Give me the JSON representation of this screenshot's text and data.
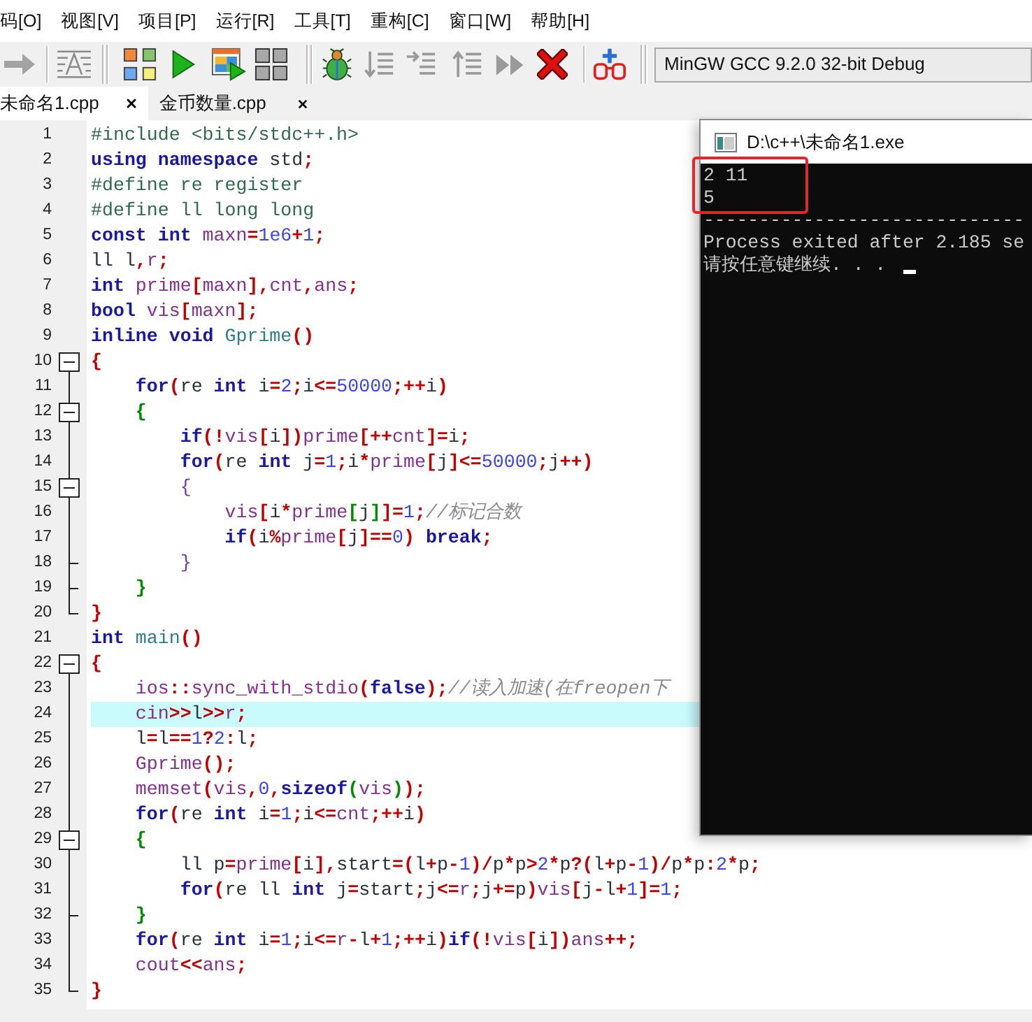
{
  "menu": [
    "码[O]",
    "视图[V]",
    "项目[P]",
    "运行[R]",
    "工具[T]",
    "重构[C]",
    "窗口[W]",
    "帮助[H]"
  ],
  "toolbar": {
    "compiler": "MinGW GCC 9.2.0 32-bit Debug"
  },
  "tabs": [
    {
      "label": "未命名1.cpp",
      "selected": true
    },
    {
      "label": "金币数量.cpp",
      "selected": false
    }
  ],
  "editor": {
    "lines": [
      {
        "number": "1",
        "selected": false,
        "kind": "plain",
        "tokens": [
          {
            "text": "#include <bits/stdc++.h>",
            "kind": "preprocessor"
          }
        ]
      },
      {
        "number": "2",
        "selected": false,
        "kind": "plain",
        "tokens": [
          {
            "text": "using namespace",
            "kind": "keyword"
          },
          {
            "text": " std",
            "kind": "plain"
          },
          {
            "text": ";",
            "kind": "symbol"
          }
        ]
      },
      {
        "number": "3",
        "selected": false,
        "kind": "plain",
        "tokens": [
          {
            "text": "#define re register",
            "kind": "preprocessor"
          }
        ]
      },
      {
        "number": "4",
        "selected": false,
        "kind": "plain",
        "tokens": [
          {
            "text": "#define ll long long",
            "kind": "preprocessor"
          }
        ]
      },
      {
        "number": "5",
        "selected": false,
        "kind": "plain",
        "tokens": [
          {
            "text": "const int",
            "kind": "keyword"
          },
          {
            "text": " maxn",
            "kind": "identifier"
          },
          {
            "text": "=",
            "kind": "symbol"
          },
          {
            "text": "1e6",
            "kind": "number"
          },
          {
            "text": "+",
            "kind": "symbol"
          },
          {
            "text": "1",
            "kind": "number"
          },
          {
            "text": ";",
            "kind": "symbol"
          }
        ]
      },
      {
        "number": "6",
        "selected": false,
        "kind": "plain",
        "tokens": [
          {
            "text": "ll l",
            "kind": "plain"
          },
          {
            "text": ",",
            "kind": "symbol"
          },
          {
            "text": "r",
            "kind": "identifier"
          },
          {
            "text": ";",
            "kind": "symbol"
          }
        ]
      },
      {
        "number": "7",
        "selected": false,
        "kind": "plain",
        "tokens": [
          {
            "text": "int",
            "kind": "keyword"
          },
          {
            "text": " prime",
            "kind": "identifier"
          },
          {
            "text": "[",
            "kind": "symbol"
          },
          {
            "text": "maxn",
            "kind": "identifier"
          },
          {
            "text": "],",
            "kind": "symbol"
          },
          {
            "text": "cnt",
            "kind": "identifier"
          },
          {
            "text": ",",
            "kind": "symbol"
          },
          {
            "text": "ans",
            "kind": "identifier"
          },
          {
            "text": ";",
            "kind": "symbol"
          }
        ]
      },
      {
        "number": "8",
        "selected": false,
        "kind": "plain",
        "tokens": [
          {
            "text": "bool",
            "kind": "keyword"
          },
          {
            "text": " vis",
            "kind": "identifier"
          },
          {
            "text": "[",
            "kind": "symbol"
          },
          {
            "text": "maxn",
            "kind": "identifier"
          },
          {
            "text": "];",
            "kind": "symbol"
          }
        ]
      },
      {
        "number": "9",
        "selected": false,
        "kind": "plain",
        "tokens": [
          {
            "text": "inline void",
            "kind": "keyword"
          },
          {
            "text": " Gprime",
            "kind": "function"
          },
          {
            "text": "()",
            "kind": "symbol"
          }
        ]
      },
      {
        "number": "10",
        "selected": false,
        "kind": "block",
        "expanded": true,
        "tokens": [
          {
            "text": "{",
            "kind": "symbol"
          }
        ]
      },
      {
        "number": "11",
        "selected": false,
        "kind": "plain",
        "tokens": [
          {
            "text": "    for",
            "kind": "keyword"
          },
          {
            "text": "(",
            "kind": "symbol"
          },
          {
            "text": "re ",
            "kind": "plain"
          },
          {
            "text": "int",
            "kind": "keyword"
          },
          {
            "text": " i",
            "kind": "plain"
          },
          {
            "text": "=",
            "kind": "symbol"
          },
          {
            "text": "2",
            "kind": "number"
          },
          {
            "text": ";",
            "kind": "symbol"
          },
          {
            "text": "i",
            "kind": "plain"
          },
          {
            "text": "<=",
            "kind": "symbol"
          },
          {
            "text": "50000",
            "kind": "number"
          },
          {
            "text": ";++",
            "kind": "symbol"
          },
          {
            "text": "i",
            "kind": "plain"
          },
          {
            "text": ")",
            "kind": "symbol"
          }
        ]
      },
      {
        "number": "12",
        "selected": false,
        "kind": "block",
        "expanded": true,
        "tokens": [
          {
            "text": "    {",
            "kind": "inner"
          }
        ]
      },
      {
        "number": "13",
        "selected": false,
        "kind": "plain",
        "tokens": [
          {
            "text": "        if",
            "kind": "keyword"
          },
          {
            "text": "(!",
            "kind": "symbol"
          },
          {
            "text": "vis",
            "kind": "identifier"
          },
          {
            "text": "[",
            "kind": "symbol"
          },
          {
            "text": "i",
            "kind": "plain"
          },
          {
            "text": "])",
            "kind": "symbol"
          },
          {
            "text": "prime",
            "kind": "identifier"
          },
          {
            "text": "[++",
            "kind": "symbol"
          },
          {
            "text": "cnt",
            "kind": "identifier"
          },
          {
            "text": "]=",
            "kind": "symbol"
          },
          {
            "text": "i",
            "kind": "plain"
          },
          {
            "text": ";",
            "kind": "symbol"
          }
        ]
      },
      {
        "number": "14",
        "selected": false,
        "kind": "plain",
        "tokens": [
          {
            "text": "        for",
            "kind": "keyword"
          },
          {
            "text": "(",
            "kind": "symbol"
          },
          {
            "text": "re ",
            "kind": "plain"
          },
          {
            "text": "int",
            "kind": "keyword"
          },
          {
            "text": " j",
            "kind": "plain"
          },
          {
            "text": "=",
            "kind": "symbol"
          },
          {
            "text": "1",
            "kind": "number"
          },
          {
            "text": ";",
            "kind": "symbol"
          },
          {
            "text": "i",
            "kind": "plain"
          },
          {
            "text": "*",
            "kind": "symbol"
          },
          {
            "text": "prime",
            "kind": "identifier"
          },
          {
            "text": "[",
            "kind": "symbol"
          },
          {
            "text": "j",
            "kind": "plain"
          },
          {
            "text": "]<=",
            "kind": "symbol"
          },
          {
            "text": "50000",
            "kind": "number"
          },
          {
            "text": ";",
            "kind": "symbol"
          },
          {
            "text": "j",
            "kind": "plain"
          },
          {
            "text": "++)",
            "kind": "symbol"
          }
        ]
      },
      {
        "number": "15",
        "selected": false,
        "kind": "block",
        "expanded": true,
        "tokens": [
          {
            "text": "        {",
            "kind": "innermost"
          }
        ]
      },
      {
        "number": "16",
        "selected": false,
        "kind": "plain",
        "tokens": [
          {
            "text": "            vis",
            "kind": "identifier"
          },
          {
            "text": "[",
            "kind": "symbol"
          },
          {
            "text": "i",
            "kind": "plain"
          },
          {
            "text": "*",
            "kind": "symbol"
          },
          {
            "text": "prime",
            "kind": "identifier"
          },
          {
            "text": "[",
            "kind": "inner"
          },
          {
            "text": "j",
            "kind": "plain"
          },
          {
            "text": "]",
            "kind": "inner"
          },
          {
            "text": "]=",
            "kind": "symbol"
          },
          {
            "text": "1",
            "kind": "number"
          },
          {
            "text": ";",
            "kind": "symbol"
          },
          {
            "text": "//标记合数",
            "kind": "comment"
          }
        ]
      },
      {
        "number": "17",
        "selected": false,
        "kind": "plain",
        "tokens": [
          {
            "text": "            if",
            "kind": "keyword"
          },
          {
            "text": "(",
            "kind": "symbol"
          },
          {
            "text": "i",
            "kind": "plain"
          },
          {
            "text": "%",
            "kind": "symbol"
          },
          {
            "text": "prime",
            "kind": "identifier"
          },
          {
            "text": "[",
            "kind": "symbol"
          },
          {
            "text": "j",
            "kind": "plain"
          },
          {
            "text": "]==",
            "kind": "symbol"
          },
          {
            "text": "0",
            "kind": "number"
          },
          {
            "text": ")",
            "kind": "symbol"
          },
          {
            "text": " break",
            "kind": "keyword"
          },
          {
            "text": ";",
            "kind": "symbol"
          }
        ]
      },
      {
        "number": "18",
        "selected": false,
        "kind": "branch",
        "tokens": [
          {
            "text": "        }",
            "kind": "innermost"
          }
        ]
      },
      {
        "number": "19",
        "selected": false,
        "kind": "branch",
        "tokens": [
          {
            "text": "    }",
            "kind": "inner"
          }
        ]
      },
      {
        "number": "20",
        "selected": false,
        "kind": "end",
        "tokens": [
          {
            "text": "}",
            "kind": "symbol"
          }
        ]
      },
      {
        "number": "21",
        "selected": false,
        "kind": "plain",
        "tokens": [
          {
            "text": "int",
            "kind": "keyword"
          },
          {
            "text": " main",
            "kind": "function"
          },
          {
            "text": "()",
            "kind": "symbol"
          }
        ]
      },
      {
        "number": "22",
        "selected": false,
        "kind": "block",
        "expanded": true,
        "tokens": [
          {
            "text": "{",
            "kind": "symbol"
          }
        ]
      },
      {
        "number": "23",
        "selected": false,
        "kind": "plain",
        "tokens": [
          {
            "text": "    ios",
            "kind": "identifier"
          },
          {
            "text": "::",
            "kind": "symbol"
          },
          {
            "text": "sync_with_stdio",
            "kind": "identifier"
          },
          {
            "text": "(",
            "kind": "symbol"
          },
          {
            "text": "false",
            "kind": "keyword"
          },
          {
            "text": ");",
            "kind": "symbol"
          },
          {
            "text": "//读入加速(在freopen下",
            "kind": "comment"
          }
        ]
      },
      {
        "number": "24",
        "selected": true,
        "kind": "plain",
        "tokens": [
          {
            "text": "    cin",
            "kind": "identifier"
          },
          {
            "text": ">>",
            "kind": "symbol"
          },
          {
            "text": "l",
            "kind": "plain"
          },
          {
            "text": ">>",
            "kind": "symbol"
          },
          {
            "text": "r",
            "kind": "identifier"
          },
          {
            "text": ";",
            "kind": "symbol"
          }
        ]
      },
      {
        "number": "25",
        "selected": false,
        "kind": "plain",
        "tokens": [
          {
            "text": "    l",
            "kind": "plain"
          },
          {
            "text": "=",
            "kind": "symbol"
          },
          {
            "text": "l",
            "kind": "plain"
          },
          {
            "text": "==",
            "kind": "symbol"
          },
          {
            "text": "1",
            "kind": "number"
          },
          {
            "text": "?",
            "kind": "symbol"
          },
          {
            "text": "2",
            "kind": "number"
          },
          {
            "text": ":",
            "kind": "symbol"
          },
          {
            "text": "l",
            "kind": "plain"
          },
          {
            "text": ";",
            "kind": "symbol"
          }
        ]
      },
      {
        "number": "26",
        "selected": false,
        "kind": "plain",
        "tokens": [
          {
            "text": "    Gprime",
            "kind": "identifier"
          },
          {
            "text": "();",
            "kind": "symbol"
          }
        ]
      },
      {
        "number": "27",
        "selected": false,
        "kind": "plain",
        "tokens": [
          {
            "text": "    memset",
            "kind": "identifier"
          },
          {
            "text": "(",
            "kind": "symbol"
          },
          {
            "text": "vis",
            "kind": "identifier"
          },
          {
            "text": ",",
            "kind": "symbol"
          },
          {
            "text": "0",
            "kind": "number"
          },
          {
            "text": ",",
            "kind": "symbol"
          },
          {
            "text": "sizeof",
            "kind": "keyword"
          },
          {
            "text": "(",
            "kind": "inner"
          },
          {
            "text": "vis",
            "kind": "identifier"
          },
          {
            "text": ")",
            "kind": "inner"
          },
          {
            "text": ");",
            "kind": "symbol"
          }
        ]
      },
      {
        "number": "28",
        "selected": false,
        "kind": "plain",
        "tokens": [
          {
            "text": "    for",
            "kind": "keyword"
          },
          {
            "text": "(",
            "kind": "symbol"
          },
          {
            "text": "re ",
            "kind": "plain"
          },
          {
            "text": "int",
            "kind": "keyword"
          },
          {
            "text": " i",
            "kind": "plain"
          },
          {
            "text": "=",
            "kind": "symbol"
          },
          {
            "text": "1",
            "kind": "number"
          },
          {
            "text": ";",
            "kind": "symbol"
          },
          {
            "text": "i",
            "kind": "plain"
          },
          {
            "text": "<=",
            "kind": "symbol"
          },
          {
            "text": "cnt",
            "kind": "identifier"
          },
          {
            "text": ";++",
            "kind": "symbol"
          },
          {
            "text": "i",
            "kind": "plain"
          },
          {
            "text": ")",
            "kind": "symbol"
          }
        ]
      },
      {
        "number": "29",
        "selected": false,
        "kind": "block",
        "expanded": true,
        "tokens": [
          {
            "text": "    {",
            "kind": "inner"
          }
        ]
      },
      {
        "number": "30",
        "selected": false,
        "kind": "plain",
        "tokens": [
          {
            "text": "        ll p",
            "kind": "plain"
          },
          {
            "text": "=",
            "kind": "symbol"
          },
          {
            "text": "prime",
            "kind": "identifier"
          },
          {
            "text": "[",
            "kind": "symbol"
          },
          {
            "text": "i",
            "kind": "plain"
          },
          {
            "text": "],",
            "kind": "symbol"
          },
          {
            "text": "start",
            "kind": "plain"
          },
          {
            "text": "=(",
            "kind": "symbol"
          },
          {
            "text": "l",
            "kind": "plain"
          },
          {
            "text": "+",
            "kind": "symbol"
          },
          {
            "text": "p",
            "kind": "plain"
          },
          {
            "text": "-",
            "kind": "symbol"
          },
          {
            "text": "1",
            "kind": "number"
          },
          {
            "text": ")/",
            "kind": "symbol"
          },
          {
            "text": "p",
            "kind": "plain"
          },
          {
            "text": "*",
            "kind": "symbol"
          },
          {
            "text": "p",
            "kind": "plain"
          },
          {
            "text": ">",
            "kind": "symbol"
          },
          {
            "text": "2",
            "kind": "number"
          },
          {
            "text": "*",
            "kind": "symbol"
          },
          {
            "text": "p",
            "kind": "plain"
          },
          {
            "text": "?(",
            "kind": "symbol"
          },
          {
            "text": "l",
            "kind": "plain"
          },
          {
            "text": "+",
            "kind": "symbol"
          },
          {
            "text": "p",
            "kind": "plain"
          },
          {
            "text": "-",
            "kind": "symbol"
          },
          {
            "text": "1",
            "kind": "number"
          },
          {
            "text": ")/",
            "kind": "symbol"
          },
          {
            "text": "p",
            "kind": "plain"
          },
          {
            "text": "*",
            "kind": "symbol"
          },
          {
            "text": "p",
            "kind": "plain"
          },
          {
            "text": ":",
            "kind": "symbol"
          },
          {
            "text": "2",
            "kind": "number"
          },
          {
            "text": "*",
            "kind": "symbol"
          },
          {
            "text": "p",
            "kind": "plain"
          },
          {
            "text": ";",
            "kind": "symbol"
          }
        ]
      },
      {
        "number": "31",
        "selected": false,
        "kind": "plain",
        "tokens": [
          {
            "text": "        for",
            "kind": "keyword"
          },
          {
            "text": "(",
            "kind": "symbol"
          },
          {
            "text": "re ll ",
            "kind": "plain"
          },
          {
            "text": "int",
            "kind": "keyword"
          },
          {
            "text": " j",
            "kind": "plain"
          },
          {
            "text": "=",
            "kind": "symbol"
          },
          {
            "text": "start",
            "kind": "plain"
          },
          {
            "text": ";",
            "kind": "symbol"
          },
          {
            "text": "j",
            "kind": "plain"
          },
          {
            "text": "<=",
            "kind": "symbol"
          },
          {
            "text": "r",
            "kind": "identifier"
          },
          {
            "text": ";",
            "kind": "symbol"
          },
          {
            "text": "j",
            "kind": "plain"
          },
          {
            "text": "+=",
            "kind": "symbol"
          },
          {
            "text": "p",
            "kind": "plain"
          },
          {
            "text": ")",
            "kind": "symbol"
          },
          {
            "text": "vis",
            "kind": "identifier"
          },
          {
            "text": "[",
            "kind": "symbol"
          },
          {
            "text": "j",
            "kind": "plain"
          },
          {
            "text": "-",
            "kind": "symbol"
          },
          {
            "text": "l",
            "kind": "plain"
          },
          {
            "text": "+",
            "kind": "symbol"
          },
          {
            "text": "1",
            "kind": "number"
          },
          {
            "text": "]=",
            "kind": "symbol"
          },
          {
            "text": "1",
            "kind": "number"
          },
          {
            "text": ";",
            "kind": "symbol"
          }
        ]
      },
      {
        "number": "32",
        "selected": false,
        "kind": "branch",
        "tokens": [
          {
            "text": "    }",
            "kind": "inner"
          }
        ]
      },
      {
        "number": "33",
        "selected": false,
        "kind": "plain",
        "tokens": [
          {
            "text": "    for",
            "kind": "keyword"
          },
          {
            "text": "(",
            "kind": "symbol"
          },
          {
            "text": "re ",
            "kind": "plain"
          },
          {
            "text": "int",
            "kind": "keyword"
          },
          {
            "text": " i",
            "kind": "plain"
          },
          {
            "text": "=",
            "kind": "symbol"
          },
          {
            "text": "1",
            "kind": "number"
          },
          {
            "text": ";",
            "kind": "symbol"
          },
          {
            "text": "i",
            "kind": "plain"
          },
          {
            "text": "<=",
            "kind": "symbol"
          },
          {
            "text": "r",
            "kind": "identifier"
          },
          {
            "text": "-",
            "kind": "symbol"
          },
          {
            "text": "l",
            "kind": "plain"
          },
          {
            "text": "+",
            "kind": "symbol"
          },
          {
            "text": "1",
            "kind": "number"
          },
          {
            "text": ";++",
            "kind": "symbol"
          },
          {
            "text": "i",
            "kind": "plain"
          },
          {
            "text": ")",
            "kind": "symbol"
          },
          {
            "text": "if",
            "kind": "keyword"
          },
          {
            "text": "(!",
            "kind": "symbol"
          },
          {
            "text": "vis",
            "kind": "identifier"
          },
          {
            "text": "[",
            "kind": "symbol"
          },
          {
            "text": "i",
            "kind": "plain"
          },
          {
            "text": "])",
            "kind": "symbol"
          },
          {
            "text": "ans",
            "kind": "identifier"
          },
          {
            "text": "++;",
            "kind": "symbol"
          }
        ]
      },
      {
        "number": "34",
        "selected": false,
        "kind": "plain",
        "tokens": [
          {
            "text": "    cout",
            "kind": "identifier"
          },
          {
            "text": "<<",
            "kind": "symbol"
          },
          {
            "text": "ans",
            "kind": "identifier"
          },
          {
            "text": ";",
            "kind": "symbol"
          }
        ]
      },
      {
        "number": "35",
        "selected": false,
        "kind": "end",
        "tokens": [
          {
            "text": "}",
            "kind": "symbol"
          }
        ]
      }
    ]
  },
  "console": {
    "title": "D:\\c++\\未命名1.exe",
    "output": [
      "2 11",
      "5",
      "-----------------------------",
      "Process exited after 2.185 se",
      "请按任意键继续. . ."
    ]
  }
}
